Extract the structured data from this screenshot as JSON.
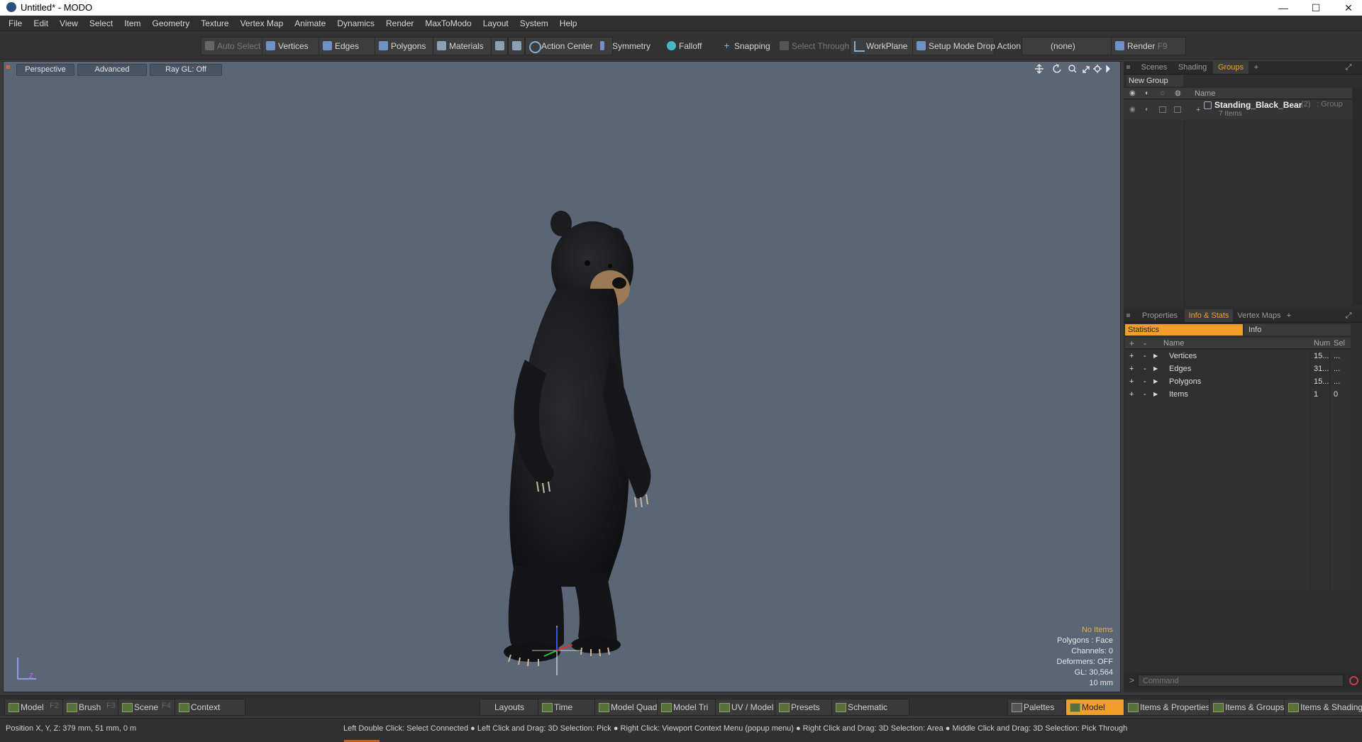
{
  "window": {
    "title": "Untitled* - MODO",
    "minimize": "—",
    "maximize": "☐",
    "close": "✕"
  },
  "menu": [
    "File",
    "Edit",
    "View",
    "Select",
    "Item",
    "Geometry",
    "Texture",
    "Vertex Map",
    "Animate",
    "Dynamics",
    "Render",
    "MaxToModo",
    "Layout",
    "System",
    "Help"
  ],
  "toolbar": {
    "auto_select": "Auto Select",
    "vertices": "Vertices",
    "edges": "Edges",
    "polygons": "Polygons",
    "materials": "Materials",
    "action_center": "Action Center",
    "symmetry": "Symmetry",
    "falloff": "Falloff",
    "snapping": "Snapping",
    "select_through": "Select Through",
    "workplane": "WorkPlane",
    "setup_mode": "Setup Mode",
    "drop_action_label": "Drop Action",
    "drop_action_value": "(none)",
    "render": "Render",
    "render_key": "F9"
  },
  "viewport": {
    "view_mode": "Perspective",
    "shading": "Advanced",
    "raygl": "Ray GL: Off",
    "info": {
      "selection": "No Items",
      "polygons": "Polygons : Face",
      "channels": "Channels: 0",
      "deformers": "Deformers: OFF",
      "gl": "GL: 30,564",
      "grid": "10 mm"
    },
    "axis_label": "Z"
  },
  "groups_panel": {
    "tabs": [
      "Scenes",
      "Shading",
      "Groups"
    ],
    "active_tab": "Groups",
    "new_group": "New Group",
    "name_header": "Name",
    "group": {
      "name": "Standing_Black_Bear",
      "count": "(2)",
      "type": ": Group",
      "items": "7 Items"
    }
  },
  "stats_panel": {
    "tabs": [
      "Properties",
      "Info & Stats",
      "Vertex Maps"
    ],
    "active_tab": "Info & Stats",
    "subtabs": [
      "Statistics",
      "Info"
    ],
    "headers": {
      "name": "Name",
      "num": "Num",
      "sel": "Sel"
    },
    "rows": [
      {
        "name": "Vertices",
        "num": "15...",
        "sel": "..."
      },
      {
        "name": "Edges",
        "num": "31...",
        "sel": "..."
      },
      {
        "name": "Polygons",
        "num": "15...",
        "sel": "..."
      },
      {
        "name": "Items",
        "num": "1",
        "sel": "0"
      }
    ],
    "command_placeholder": "Command"
  },
  "bottom_bar": {
    "left": [
      {
        "label": "Model",
        "key": "F2"
      },
      {
        "label": "Brush",
        "key": "F3"
      },
      {
        "label": "Scene",
        "key": "F4"
      },
      {
        "label": "Context",
        "key": ""
      }
    ],
    "layouts": "Layouts",
    "center": [
      "Time",
      "Model Quad",
      "Model Tri",
      "UV / Model",
      "Presets",
      "Schematic"
    ],
    "palettes": "Palettes",
    "model_active": "Model",
    "right": [
      "Items & Properties",
      "Items & Groups",
      "Items & Shading"
    ]
  },
  "status": {
    "position": "Position X, Y, Z:   379 mm, 51 mm, 0 m",
    "hints": "Left Double Click: Select Connected ● Left Click and Drag: 3D Selection: Pick ● Right Click: Viewport Context Menu (popup menu) ● Right Click and Drag: 3D Selection: Area ● Middle Click and Drag: 3D Selection: Pick Through"
  },
  "colors": {
    "accent": "#f0a028",
    "viewport_bg": "#5a6676",
    "panel_bg": "#2e2e2e"
  }
}
